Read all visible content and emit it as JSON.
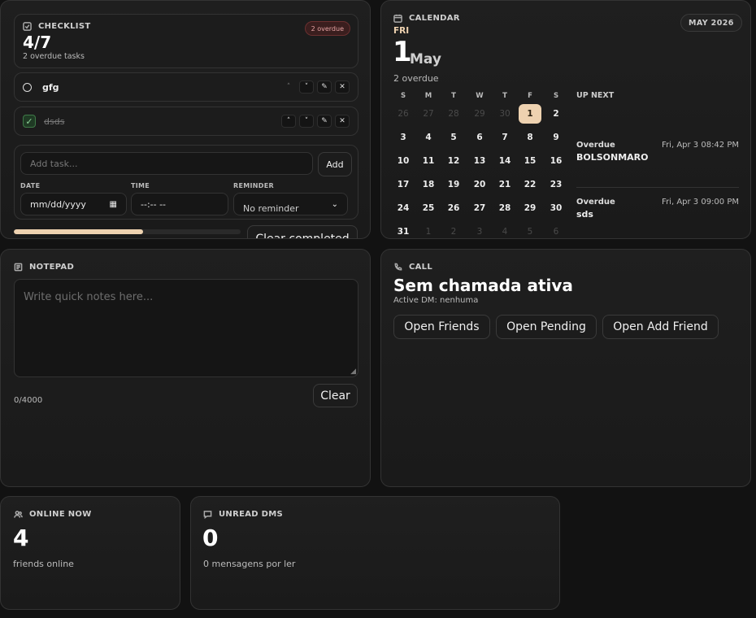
{
  "checklist": {
    "label": "CHECKLIST",
    "overdue_badge": "2 overdue",
    "progress_count": "4/7",
    "subtitle": "2 overdue tasks",
    "tasks": [
      {
        "text": "gfg",
        "done": false
      },
      {
        "text": "dsds",
        "done": true
      }
    ],
    "add_placeholder": "Add task...",
    "add_button": "Add",
    "date_label": "DATE",
    "date_placeholder": "mm/dd/yyyy",
    "time_label": "TIME",
    "time_placeholder": "--:-- --",
    "reminder_label": "REMINDER",
    "reminder_value": "No reminder",
    "progress_fraction": 0.57,
    "clear_completed": "Clear completed"
  },
  "calendar": {
    "label": "CALENDAR",
    "month_badge": "MAY 2026",
    "weekday": "FRI",
    "day": "1",
    "month": "May",
    "overdue_text": "2 overdue",
    "dows": [
      "S",
      "M",
      "T",
      "W",
      "T",
      "F",
      "S"
    ],
    "weeks": [
      [
        [
          "26",
          0
        ],
        [
          "27",
          0
        ],
        [
          "28",
          0
        ],
        [
          "29",
          0
        ],
        [
          "30",
          0
        ],
        [
          "1",
          2
        ],
        [
          "2",
          1
        ]
      ],
      [
        [
          "3",
          1
        ],
        [
          "4",
          1
        ],
        [
          "5",
          1
        ],
        [
          "6",
          1
        ],
        [
          "7",
          1
        ],
        [
          "8",
          1
        ],
        [
          "9",
          1
        ]
      ],
      [
        [
          "10",
          1
        ],
        [
          "11",
          1
        ],
        [
          "12",
          1
        ],
        [
          "13",
          1
        ],
        [
          "14",
          1
        ],
        [
          "15",
          1
        ],
        [
          "16",
          1
        ]
      ],
      [
        [
          "17",
          1
        ],
        [
          "18",
          1
        ],
        [
          "19",
          1
        ],
        [
          "20",
          1
        ],
        [
          "21",
          1
        ],
        [
          "22",
          1
        ],
        [
          "23",
          1
        ]
      ],
      [
        [
          "24",
          1
        ],
        [
          "25",
          1
        ],
        [
          "26",
          1
        ],
        [
          "27",
          1
        ],
        [
          "28",
          1
        ],
        [
          "29",
          1
        ],
        [
          "30",
          1
        ]
      ],
      [
        [
          "31",
          1
        ],
        [
          "1",
          0
        ],
        [
          "2",
          0
        ],
        [
          "3",
          0
        ],
        [
          "4",
          0
        ],
        [
          "5",
          0
        ],
        [
          "6",
          0
        ]
      ]
    ],
    "up_next_label": "UP NEXT",
    "events": [
      {
        "status": "Overdue",
        "title": "BOLSONMARO",
        "when": "Fri, Apr 3 08:42 PM"
      },
      {
        "status": "Overdue",
        "title": "sds",
        "when": "Fri, Apr 3 09:00 PM"
      }
    ]
  },
  "notepad": {
    "label": "NOTEPAD",
    "placeholder": "Write quick notes here...",
    "counter": "0/4000",
    "clear_button": "Clear"
  },
  "call": {
    "label": "CALL",
    "title": "Sem chamada ativa",
    "active_dm": "Active DM: nenhuma",
    "buttons": [
      "Open Friends",
      "Open Pending",
      "Open Add Friend"
    ]
  },
  "online": {
    "label": "ONLINE NOW",
    "count": "4",
    "caption": "friends online"
  },
  "unread": {
    "label": "UNREAD DMS",
    "count": "0",
    "caption": "0 mensagens por ler"
  }
}
